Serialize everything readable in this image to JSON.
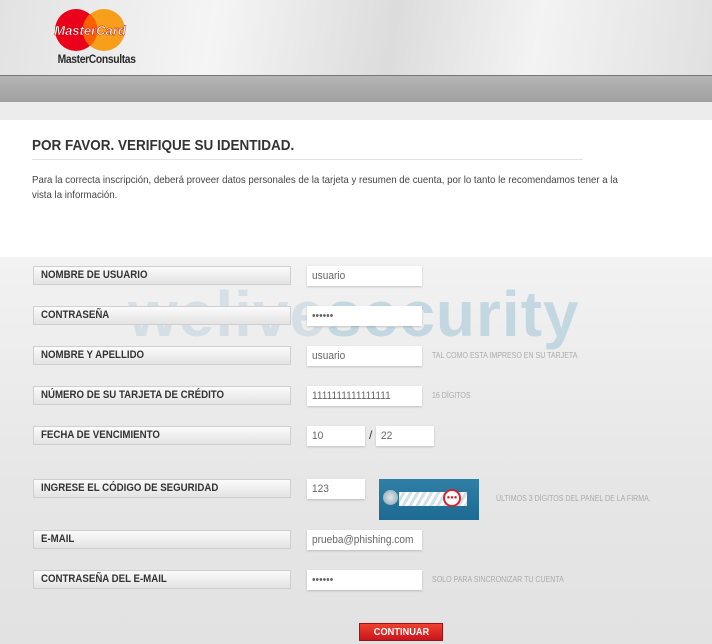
{
  "header": {
    "logo_wordmark": "MasterCard",
    "logo_caption": "MasterConsultas",
    "brand_colors": {
      "red": "#eb001b",
      "orange": "#f79e1b"
    }
  },
  "intro": {
    "title": "POR FAVOR. VERIFIQUE SU IDENTIDAD.",
    "description": "Para la correcta inscripción, deberá proveer datos personales de la tarjeta y resumen de cuenta, por lo tanto le recomendamos tener a la vista la información."
  },
  "watermark": {
    "part1": "welive",
    "part2": "security"
  },
  "form": {
    "fields": [
      {
        "label": "NOMBRE DE USUARIO",
        "value": "usuario",
        "hint": ""
      },
      {
        "label": "CONTRASEÑA",
        "value": "••••••",
        "hint": ""
      },
      {
        "label": "NOMBRE Y APELLIDO",
        "value": "usuario",
        "hint": "TAL COMO ESTA IMPRESO EN SU TARJETA"
      },
      {
        "label": "NÚMERO DE SU TARJETA DE CRÉDITO",
        "value": "1111111111111111",
        "hint": "16 DÍGITOS"
      },
      {
        "label": "FECHA DE VENCIMIENTO",
        "month": "10",
        "separator": "/",
        "year": "22"
      },
      {
        "label": "INGRESE EL CÓDIGO DE SEGURIDAD",
        "value": "123",
        "hint": "ÚLTIMOS 3 DÍGITOS DEL PANEL DE LA FIRMA."
      },
      {
        "label": "E-MAIL",
        "value": "prueba@phishing.com",
        "hint": ""
      },
      {
        "label": "CONTRASEÑA DEL E-MAIL",
        "value": "••••••",
        "hint": "SOLO PARA SINCRONIZAR TU CUENTA"
      }
    ],
    "submit_label": "CONTINUAR",
    "accent_color": "#d9231f"
  }
}
